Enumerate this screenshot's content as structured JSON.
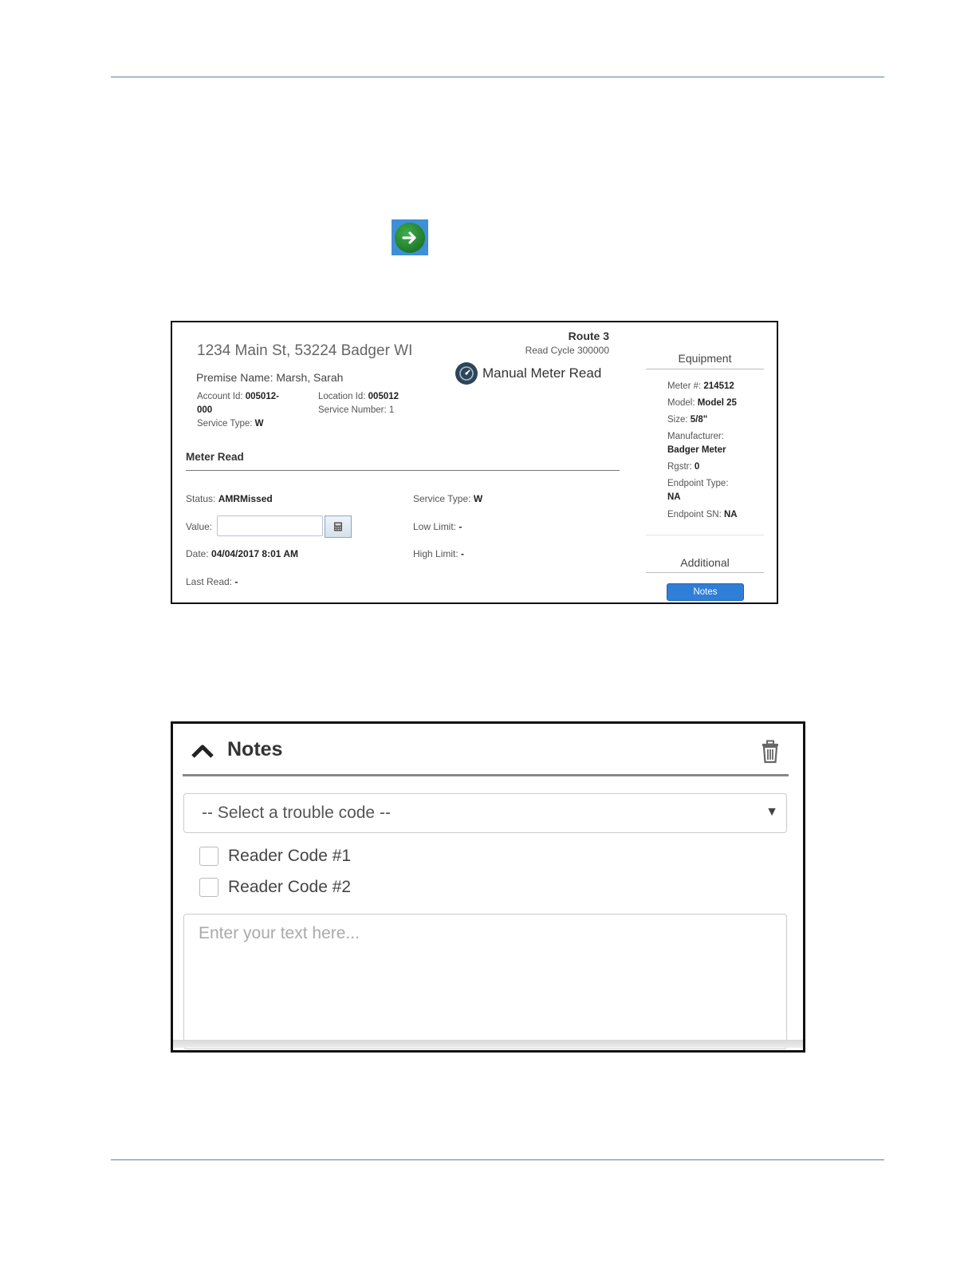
{
  "screenshot1": {
    "address": "1234 Main St, 53224 Badger WI",
    "route": "Route 3",
    "read_cycle": "Read Cycle 300000",
    "manual_meter_read": "Manual Meter Read",
    "premise_name": "Premise Name: Marsh, Sarah",
    "account": {
      "label": "Account Id: ",
      "value_line1": "005012-",
      "value_line2": "000"
    },
    "service_type": {
      "label": "Service Type: ",
      "value": "W"
    },
    "location": {
      "label": "Location Id: ",
      "value": "005012"
    },
    "service_number": {
      "label": "Service Number: ",
      "value": "1"
    },
    "meter_read_heading": "Meter Read",
    "fields": {
      "status_label": "Status: ",
      "status_value": "AMRMissed",
      "value_label": "Value:",
      "date_label": "Date: ",
      "date_value": "04/04/2017 8:01 AM",
      "last_read_label": "Last Read: ",
      "last_read_value": "-",
      "service_type_label": "Service Type: ",
      "service_type_value": "W",
      "low_limit_label": "Low Limit: ",
      "low_limit_value": "-",
      "high_limit_label": "High Limit: ",
      "high_limit_value": "-"
    },
    "equipment": {
      "heading": "Equipment",
      "meter_label": "Meter #: ",
      "meter_value": "214512",
      "model_label": "Model: ",
      "model_value": "Model 25",
      "size_label": "Size: ",
      "size_value": "5/8\"",
      "manufacturer_label": "Manufacturer:",
      "manufacturer_value": "Badger Meter",
      "rgstr_label": "Rgstr: ",
      "rgstr_value": "0",
      "endpoint_type_label": "Endpoint Type:",
      "endpoint_type_value": "NA",
      "endpoint_sn_label": "Endpoint SN: ",
      "endpoint_sn_value": "NA"
    },
    "additional": {
      "heading": "Additional",
      "notes_button": "Notes"
    }
  },
  "screenshot2": {
    "title": "Notes",
    "trouble_code_select": "-- Select a trouble code --",
    "checkboxes": [
      "Reader Code #1",
      "Reader Code #2"
    ],
    "textarea_placeholder": "Enter your text here..."
  },
  "colors": {
    "rule": "#5b7fa6",
    "notes_button": "#2f7fd8",
    "arrow_green": "#1f7a2b",
    "arrow_bg": "#3f8fd6"
  },
  "icons": [
    "arrow-right-icon",
    "gauge-icon",
    "calculator-icon",
    "chevron-up-icon",
    "trash-icon",
    "dropdown-caret-icon"
  ]
}
